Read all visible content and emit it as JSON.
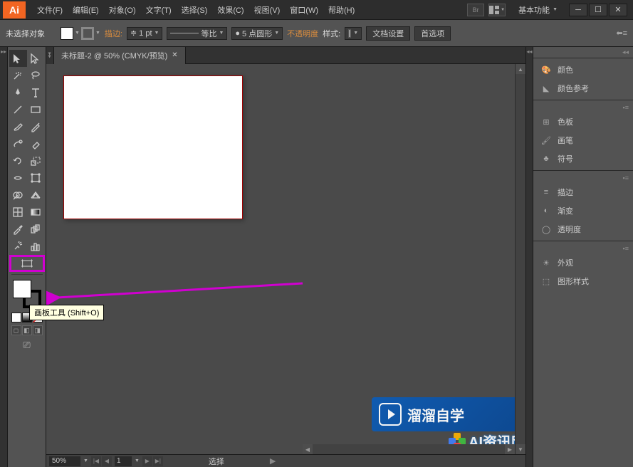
{
  "app": {
    "logo": "Ai"
  },
  "menu": [
    "文件(F)",
    "编辑(E)",
    "对象(O)",
    "文字(T)",
    "选择(S)",
    "效果(C)",
    "视图(V)",
    "窗口(W)",
    "帮助(H)"
  ],
  "search_placeholder": "Br",
  "workspace": "基本功能",
  "control": {
    "no_selection": "未选择对象",
    "stroke_label": "描边:",
    "stroke_value": "1 pt",
    "uniform": "等比",
    "brush_value": "5 点圆形",
    "opacity_label": "不透明度",
    "style_label": "样式:",
    "doc_setup": "文档设置",
    "preferences": "首选项"
  },
  "document": {
    "tab_title": "未标题-2 @ 50% (CMYK/预览)",
    "zoom": "50%",
    "page": "1",
    "status": "选择"
  },
  "tooltip": "画板工具 (Shift+O)",
  "panels": {
    "color": "颜色",
    "color_guide": "颜色参考",
    "swatches": "色板",
    "brushes": "画笔",
    "symbols": "符号",
    "stroke": "描边",
    "gradient": "渐变",
    "transparency": "透明度",
    "appearance": "外观",
    "graphic_styles": "图形样式"
  },
  "watermark": {
    "text1": "溜溜自学",
    "text2": "AI资讯网"
  }
}
